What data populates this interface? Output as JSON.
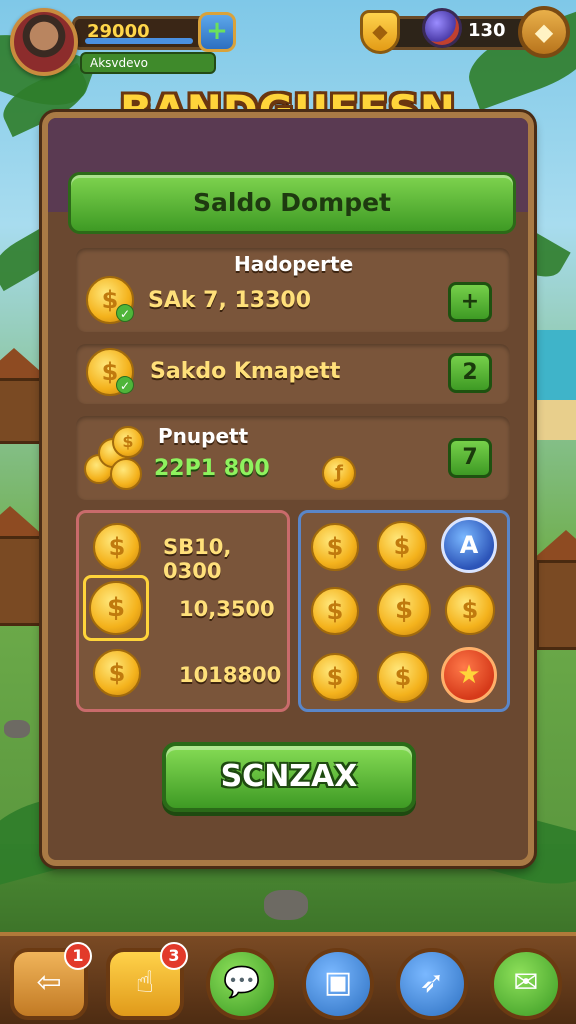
{
  "hud": {
    "level_value": "29000",
    "player_name": "Aksvdevo",
    "plus_symbol": "+",
    "resource_value": "130",
    "shield_symbol": "◆",
    "menu_symbol": "◆"
  },
  "title": "BANDGUFESN",
  "panel": {
    "header": "Saldo Dompet",
    "row1": {
      "title": "Hadoperte",
      "label": "SAk 7, 13300",
      "button": "+"
    },
    "row2": {
      "label": "Sakdo Kmapett",
      "button": "2"
    },
    "row3": {
      "title": "Pnupett",
      "value": "22P1 800",
      "button": "7"
    },
    "left_grid_values": [
      "SB10, 0300",
      "10,3500",
      "1018800"
    ],
    "confirm": "SCNZAX"
  },
  "nav": {
    "badge1": "1",
    "badge2": "3"
  },
  "colors": {
    "panel_bg": "#6a4830",
    "green_button": "#3e9a24",
    "gold": "#ffd43a",
    "left_grid_border": "#c96b6b",
    "right_grid_border": "#5a86c8"
  },
  "icons": [
    "avatar",
    "plus-icon",
    "shield-icon",
    "orb-icon",
    "menu-icon",
    "coin-icon",
    "coin-pile-icon",
    "blue-token-icon",
    "red-star-token-icon",
    "back-arrow-icon",
    "hand-icon",
    "chat-icon",
    "box-icon",
    "rocket-icon",
    "ticket-icon"
  ]
}
